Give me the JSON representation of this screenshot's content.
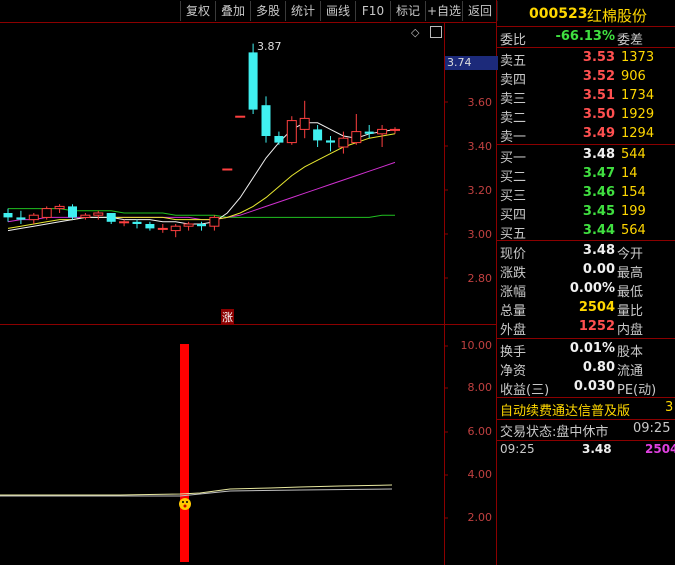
{
  "toolbar": {
    "buttons": [
      "复权",
      "叠加",
      "多股",
      "统计",
      "画线",
      "F10",
      "标记",
      "+自选",
      "返回"
    ]
  },
  "chart": {
    "price_axis": [
      "3.60",
      "3.40",
      "3.20",
      "3.00",
      "2.80"
    ],
    "current_price_tag": "3.74",
    "high_label": "3.87",
    "zhang_marker": "涨",
    "indicator_axis": [
      "10.00",
      "8.00",
      "6.00",
      "4.00",
      "2.00"
    ],
    "candles": [
      {
        "o": 3.1,
        "c": 3.08,
        "h": 3.12,
        "l": 3.06
      },
      {
        "o": 3.08,
        "c": 3.07,
        "h": 3.11,
        "l": 3.05
      },
      {
        "o": 3.07,
        "c": 3.09,
        "h": 3.1,
        "l": 3.05
      },
      {
        "o": 3.08,
        "c": 3.12,
        "h": 3.13,
        "l": 3.07
      },
      {
        "o": 3.12,
        "c": 3.13,
        "h": 3.14,
        "l": 3.1
      },
      {
        "o": 3.13,
        "c": 3.08,
        "h": 3.14,
        "l": 3.07
      },
      {
        "o": 3.08,
        "c": 3.09,
        "h": 3.1,
        "l": 3.07
      },
      {
        "o": 3.09,
        "c": 3.1,
        "h": 3.11,
        "l": 3.07
      },
      {
        "o": 3.1,
        "c": 3.06,
        "h": 3.1,
        "l": 3.05
      },
      {
        "o": 3.06,
        "c": 3.06,
        "h": 3.07,
        "l": 3.04
      },
      {
        "o": 3.06,
        "c": 3.05,
        "h": 3.07,
        "l": 3.03
      },
      {
        "o": 3.05,
        "c": 3.03,
        "h": 3.06,
        "l": 3.02
      },
      {
        "o": 3.03,
        "c": 3.03,
        "h": 3.05,
        "l": 3.01
      },
      {
        "o": 3.02,
        "c": 3.04,
        "h": 3.05,
        "l": 2.99
      },
      {
        "o": 3.04,
        "c": 3.05,
        "h": 3.06,
        "l": 3.02
      },
      {
        "o": 3.05,
        "c": 3.04,
        "h": 3.06,
        "l": 3.02
      },
      {
        "o": 3.04,
        "c": 3.08,
        "h": 3.09,
        "l": 3.02
      },
      {
        "o": 3.3,
        "c": 3.3,
        "h": 3.3,
        "l": 3.3
      },
      {
        "o": 3.54,
        "c": 3.54,
        "h": 3.54,
        "l": 3.54
      },
      {
        "o": 3.83,
        "c": 3.57,
        "h": 3.87,
        "l": 3.55
      },
      {
        "o": 3.59,
        "c": 3.45,
        "h": 3.63,
        "l": 3.42
      },
      {
        "o": 3.45,
        "c": 3.42,
        "h": 3.47,
        "l": 3.41
      },
      {
        "o": 3.42,
        "c": 3.52,
        "h": 3.54,
        "l": 3.41
      },
      {
        "o": 3.48,
        "c": 3.53,
        "h": 3.61,
        "l": 3.44
      },
      {
        "o": 3.48,
        "c": 3.43,
        "h": 3.5,
        "l": 3.4
      },
      {
        "o": 3.43,
        "c": 3.42,
        "h": 3.45,
        "l": 3.38
      },
      {
        "o": 3.4,
        "c": 3.44,
        "h": 3.47,
        "l": 3.37
      },
      {
        "o": 3.42,
        "c": 3.47,
        "h": 3.55,
        "l": 3.41
      },
      {
        "o": 3.47,
        "c": 3.46,
        "h": 3.5,
        "l": 3.44
      },
      {
        "o": 3.46,
        "c": 3.48,
        "h": 3.5,
        "l": 3.4
      },
      {
        "o": 3.48,
        "c": 3.48,
        "h": 3.49,
        "l": 3.46
      }
    ],
    "ma_white": [
      3.02,
      3.03,
      3.04,
      3.05,
      3.06,
      3.07,
      3.08,
      3.08,
      3.08,
      3.07,
      3.07,
      3.07,
      3.06,
      3.06,
      3.05,
      3.05,
      3.06,
      3.1,
      3.17,
      3.26,
      3.35,
      3.42,
      3.48,
      3.51,
      3.51,
      3.48,
      3.45,
      3.44,
      3.46,
      3.47,
      3.48
    ],
    "ma_yellow": [
      3.03,
      3.04,
      3.05,
      3.06,
      3.07,
      3.07,
      3.08,
      3.08,
      3.08,
      3.08,
      3.08,
      3.08,
      3.08,
      3.07,
      3.07,
      3.07,
      3.07,
      3.08,
      3.1,
      3.13,
      3.17,
      3.22,
      3.27,
      3.31,
      3.34,
      3.37,
      3.4,
      3.42,
      3.44,
      3.45,
      3.46
    ],
    "ma_magenta": [
      3.06,
      3.07,
      3.07,
      3.08,
      3.08,
      3.08,
      3.08,
      3.08,
      3.08,
      3.08,
      3.08,
      3.08,
      3.08,
      3.08,
      3.08,
      3.07,
      3.07,
      3.08,
      3.09,
      3.11,
      3.13,
      3.15,
      3.17,
      3.19,
      3.21,
      3.23,
      3.25,
      3.27,
      3.29,
      3.31,
      3.33
    ],
    "ma_green": [
      3.12,
      3.12,
      3.12,
      3.12,
      3.12,
      3.11,
      3.11,
      3.11,
      3.11,
      3.1,
      3.1,
      3.1,
      3.1,
      3.09,
      3.09,
      3.09,
      3.09,
      3.08,
      3.08,
      3.08,
      3.08,
      3.08,
      3.08,
      3.08,
      3.08,
      3.08,
      3.08,
      3.08,
      3.08,
      3.09,
      3.09
    ]
  },
  "panel": {
    "code": "000523",
    "name": "红棉股份",
    "weibi_label": "委比",
    "weibi_value": "-66.13%",
    "weicha_label": "委差",
    "asks": [
      {
        "label": "卖五",
        "price": "3.53",
        "vol": "1373"
      },
      {
        "label": "卖四",
        "price": "3.52",
        "vol": "906"
      },
      {
        "label": "卖三",
        "price": "3.51",
        "vol": "1734"
      },
      {
        "label": "卖二",
        "price": "3.50",
        "vol": "1929"
      },
      {
        "label": "卖一",
        "price": "3.49",
        "vol": "1294"
      }
    ],
    "bids": [
      {
        "label": "买一",
        "price": "3.48",
        "vol": "544"
      },
      {
        "label": "买二",
        "price": "3.47",
        "vol": "14"
      },
      {
        "label": "买三",
        "price": "3.46",
        "vol": "154"
      },
      {
        "label": "买四",
        "price": "3.45",
        "vol": "199"
      },
      {
        "label": "买五",
        "price": "3.44",
        "vol": "564"
      }
    ],
    "stats": [
      {
        "label": "现价",
        "value": "3.48",
        "right": "今开"
      },
      {
        "label": "涨跌",
        "value": "0.00",
        "right": "最高"
      },
      {
        "label": "涨幅",
        "value": "0.00%",
        "right": "最低"
      },
      {
        "label": "总量",
        "value": "2504",
        "right": "量比"
      },
      {
        "label": "外盘",
        "value": "1252",
        "right": "内盘"
      }
    ],
    "stats2": [
      {
        "label": "换手",
        "value": "0.01%",
        "right": "股本"
      },
      {
        "label": "净资",
        "value": "0.80",
        "right": "流通"
      },
      {
        "label": "收益(三)",
        "value": "0.030",
        "right": "PE(动)"
      }
    ],
    "promo": "自动续费通达信普及版",
    "promo_tail": "3",
    "trade_status": "交易状态:盘中休市",
    "trade_time": "09:25",
    "tick": {
      "time": "09:25",
      "price": "3.48",
      "vol": "2504"
    }
  }
}
